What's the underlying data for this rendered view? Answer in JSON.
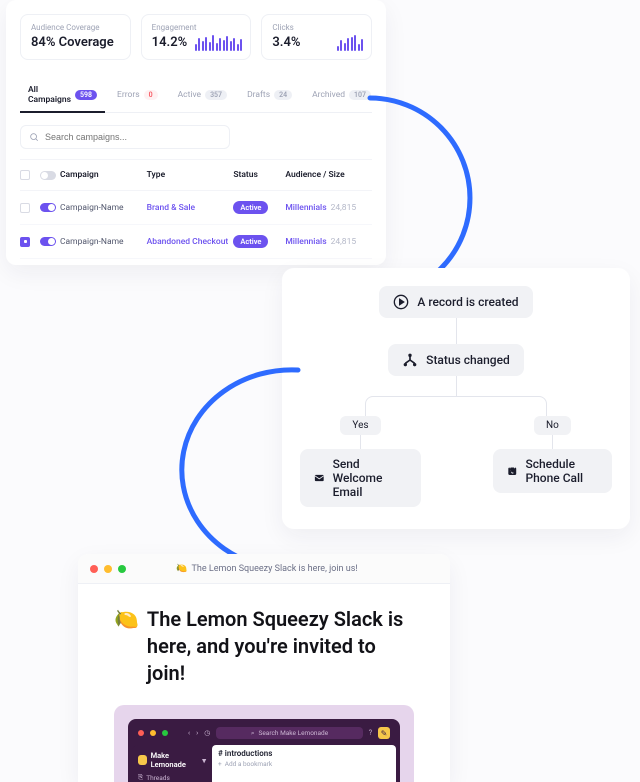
{
  "dashboard": {
    "stats": [
      {
        "label": "Audience Coverage",
        "value": "84% Coverage"
      },
      {
        "label": "Engagement",
        "value": "14.2%"
      },
      {
        "label": "Clicks",
        "value": "3.4%"
      }
    ],
    "tabs": [
      {
        "label": "All Campaigns",
        "badge": "598",
        "badge_style": "purple",
        "active": true
      },
      {
        "label": "Errors",
        "badge": "0",
        "badge_style": "red"
      },
      {
        "label": "Active",
        "badge": "357",
        "badge_style": "grey"
      },
      {
        "label": "Drafts",
        "badge": "24",
        "badge_style": "grey"
      },
      {
        "label": "Archived",
        "badge": "107",
        "badge_style": "grey"
      }
    ],
    "search_placeholder": "Search campaigns...",
    "columns": {
      "campaign": "Campaign",
      "type": "Type",
      "status": "Status",
      "audience": "Audience / Size"
    },
    "rows": [
      {
        "selected": false,
        "enabled": true,
        "name": "Campaign-Name",
        "type": "Brand & Sale",
        "status": "Active",
        "audience_name": "Millennials",
        "audience_size": "24,815"
      },
      {
        "selected": true,
        "enabled": true,
        "name": "Campaign-Name",
        "type": "Abandoned Checkout",
        "status": "Active",
        "audience_name": "Millennials",
        "audience_size": "24,815"
      }
    ]
  },
  "workflow": {
    "trigger": "A record is created",
    "condition": "Status changed",
    "branch_yes": "Yes",
    "branch_no": "No",
    "action_yes": "Send Welcome Email",
    "action_no": "Schedule Phone Call"
  },
  "browser": {
    "tab_title": "The Lemon Squeezy Slack is here, join us!",
    "headline": "The Lemon Squeezy Slack is here, and you're invited to join!",
    "lemon_emoji": "🍋",
    "slack": {
      "search_placeholder": "Search Make Lemonade",
      "workspace": "Make Lemonade",
      "section_threads": "Threads",
      "channel": "# introductions",
      "bookmark_prompt": "Add a bookmark"
    }
  }
}
